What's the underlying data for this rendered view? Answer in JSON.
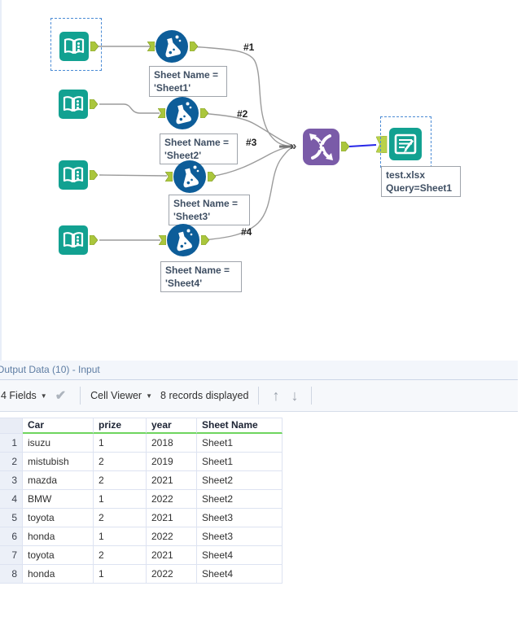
{
  "canvas": {
    "connection_labels": [
      "#1",
      "#2",
      "#3",
      "#4"
    ],
    "annotations": [
      {
        "line1": "Sheet Name =",
        "line2": "'Sheet1'"
      },
      {
        "line1": "Sheet Name =",
        "line2": "'Sheet2'"
      },
      {
        "line1": "Sheet Name =",
        "line2": "'Sheet3'"
      },
      {
        "line1": "Sheet Name =",
        "line2": "'Sheet4'"
      }
    ],
    "output_annotation": {
      "line1": "test.xlsx",
      "line2": "Query=Sheet1"
    }
  },
  "icons": {
    "caret_down": "▼",
    "check": "✔",
    "arrow_up": "↑",
    "arrow_down": "↓",
    "merge_chevron": "»"
  },
  "panel": {
    "title": "Output Data (10) - Input",
    "toolbar": {
      "fields": "4 Fields",
      "cell_viewer": "Cell Viewer",
      "records": "8 records displayed"
    },
    "table": {
      "columns": [
        "Car",
        "prize",
        "year",
        "Sheet Name"
      ],
      "rows": [
        [
          "1",
          "isuzu",
          "1",
          "2018",
          "Sheet1"
        ],
        [
          "2",
          "mistubish",
          "2",
          "2019",
          "Sheet1"
        ],
        [
          "3",
          "mazda",
          "2",
          "2021",
          "Sheet2"
        ],
        [
          "4",
          "BMW",
          "1",
          "2022",
          "Sheet2"
        ],
        [
          "5",
          "toyota",
          "2",
          "2021",
          "Sheet3"
        ],
        [
          "6",
          "honda",
          "1",
          "2022",
          "Sheet3"
        ],
        [
          "7",
          "toyota",
          "2",
          "2021",
          "Sheet4"
        ],
        [
          "8",
          "honda",
          "1",
          "2022",
          "Sheet4"
        ]
      ]
    }
  },
  "colors": {
    "input_tool_teal": "#12A191",
    "formula_tool_blue": "#0D5D99",
    "union_tool_purple": "#7A5BA8",
    "anchor_green": "#AAC63C",
    "selected_connection_blue": "#2727E8",
    "connection_gray": "#9B9B9B",
    "header_underline_green": "#6FD55F",
    "selection_dashed_blue": "#4B8BD5"
  }
}
